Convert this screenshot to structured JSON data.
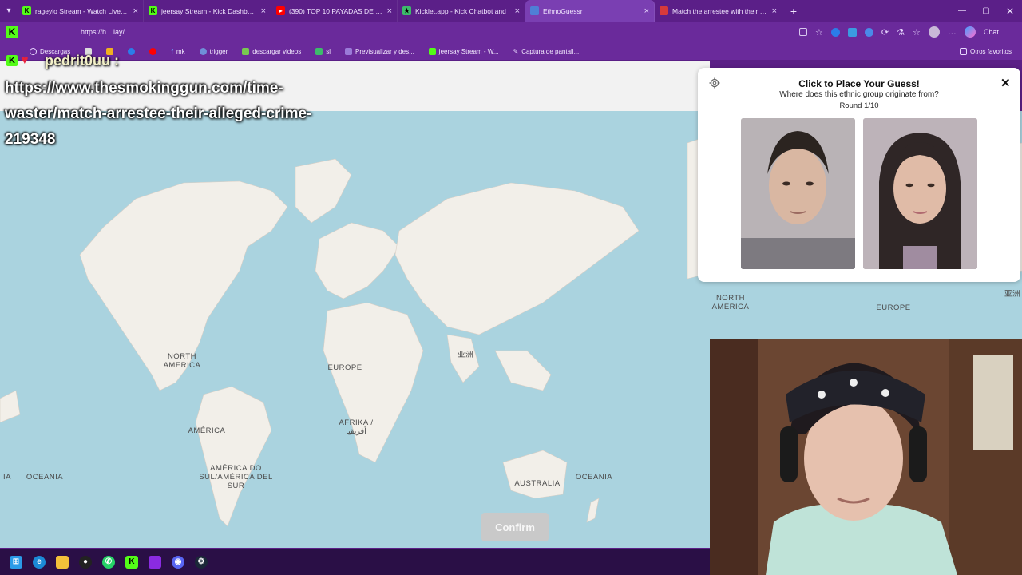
{
  "tabs": [
    {
      "title": "rageylo Stream - Watch Live on Kick",
      "active": false,
      "color": "#53fc18"
    },
    {
      "title": "jeersay Stream - Kick Dashboard",
      "active": false,
      "color": "#53fc18"
    },
    {
      "title": "(390) TOP 10 PAYADAS DE KANYE",
      "active": false,
      "color": "#ff0000"
    },
    {
      "title": "Kicklet.app - Kick Chatbot and",
      "active": false,
      "color": "#3dbb6b"
    },
    {
      "title": "EthnoGuessr",
      "active": true,
      "color": "#4f7fd6"
    },
    {
      "title": "Match the arrestee with their alleg",
      "active": false,
      "color": "#d73a3a"
    }
  ],
  "address": {
    "url": "https://h…lay/",
    "chat_label": "Chat"
  },
  "bookmarks": [
    {
      "label": "Descargas"
    },
    {
      "label": "mk"
    },
    {
      "label": "trigger"
    },
    {
      "label": "descargar videos"
    },
    {
      "label": "sl"
    },
    {
      "label": "Previsualizar y des..."
    },
    {
      "label": "jeersay Stream - W..."
    },
    {
      "label": "Captura de pantall..."
    }
  ],
  "bookmarks_other": "Otros favoritos",
  "overlay": {
    "username": "pedrit0uu :",
    "message": "https://www.thesmokinggun.com/time-waster/match-arrestee-their-alleged-crime-219348"
  },
  "map": {
    "labels": {
      "north_america": "NORTH AMERICA",
      "europe": "EUROPE",
      "asia": "亚洲",
      "africa": "AFRIKA / أفريقيا",
      "america": "AMÉRICA",
      "south_america": "AMÉRICA DO SUL/AMÉRICA DEL SUR",
      "oceania": "OCEANIA",
      "australia": "AUSTRALIA",
      "ia": "IA"
    },
    "right_labels": {
      "north_america": "NORTH AMERICA",
      "europe": "EUROPE",
      "asia": "亚洲"
    }
  },
  "confirm_label": "Confirm",
  "guess_panel": {
    "title": "Click to Place Your Guess!",
    "subtitle": "Where does this ethnic group originate from?",
    "round": "Round 1/10"
  },
  "colors": {
    "ocean": "#aad3df",
    "land": "#f2efe9",
    "browser": "#6a2a9b"
  }
}
